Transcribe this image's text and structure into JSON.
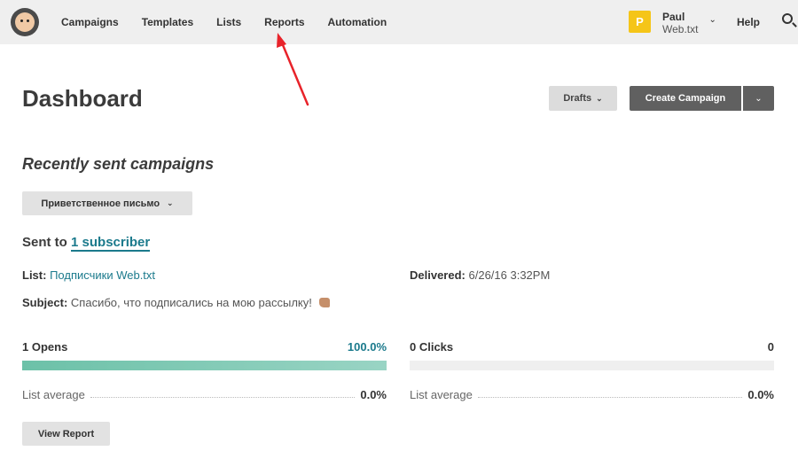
{
  "nav": {
    "items": [
      {
        "label": "Campaigns"
      },
      {
        "label": "Templates"
      },
      {
        "label": "Lists"
      },
      {
        "label": "Reports"
      },
      {
        "label": "Automation"
      }
    ]
  },
  "user": {
    "initial": "P",
    "name": "Paul",
    "org": "Web.txt"
  },
  "header": {
    "help_label": "Help"
  },
  "page": {
    "title": "Dashboard",
    "drafts_label": "Drafts",
    "create_label": "Create Campaign"
  },
  "recent": {
    "section_title": "Recently sent campaigns",
    "campaign_name": "Приветственное письмо",
    "sent_to_prefix": "Sent to",
    "subscriber_link": "1 subscriber",
    "list_label": "List:",
    "list_value": "Подписчики Web.txt",
    "delivered_label": "Delivered:",
    "delivered_value": "6/26/16 3:32PM",
    "subject_label": "Subject:",
    "subject_value": "Спасибо, что подписались на мою рассылку!"
  },
  "stats": {
    "opens_label": "1 Opens",
    "opens_value": "100.0%",
    "opens_fill": 1.0,
    "clicks_label": "0 Clicks",
    "clicks_value": "0",
    "clicks_fill": 0.0,
    "avg_label": "List average",
    "opens_avg": "0.0%",
    "clicks_avg": "0.0%",
    "view_report_label": "View Report"
  },
  "colors": {
    "accent_link": "#1b7a8c",
    "bar_fill": "#6cc1a8",
    "avatar": "#f5c518",
    "annotation_arrow": "#e8232a"
  }
}
